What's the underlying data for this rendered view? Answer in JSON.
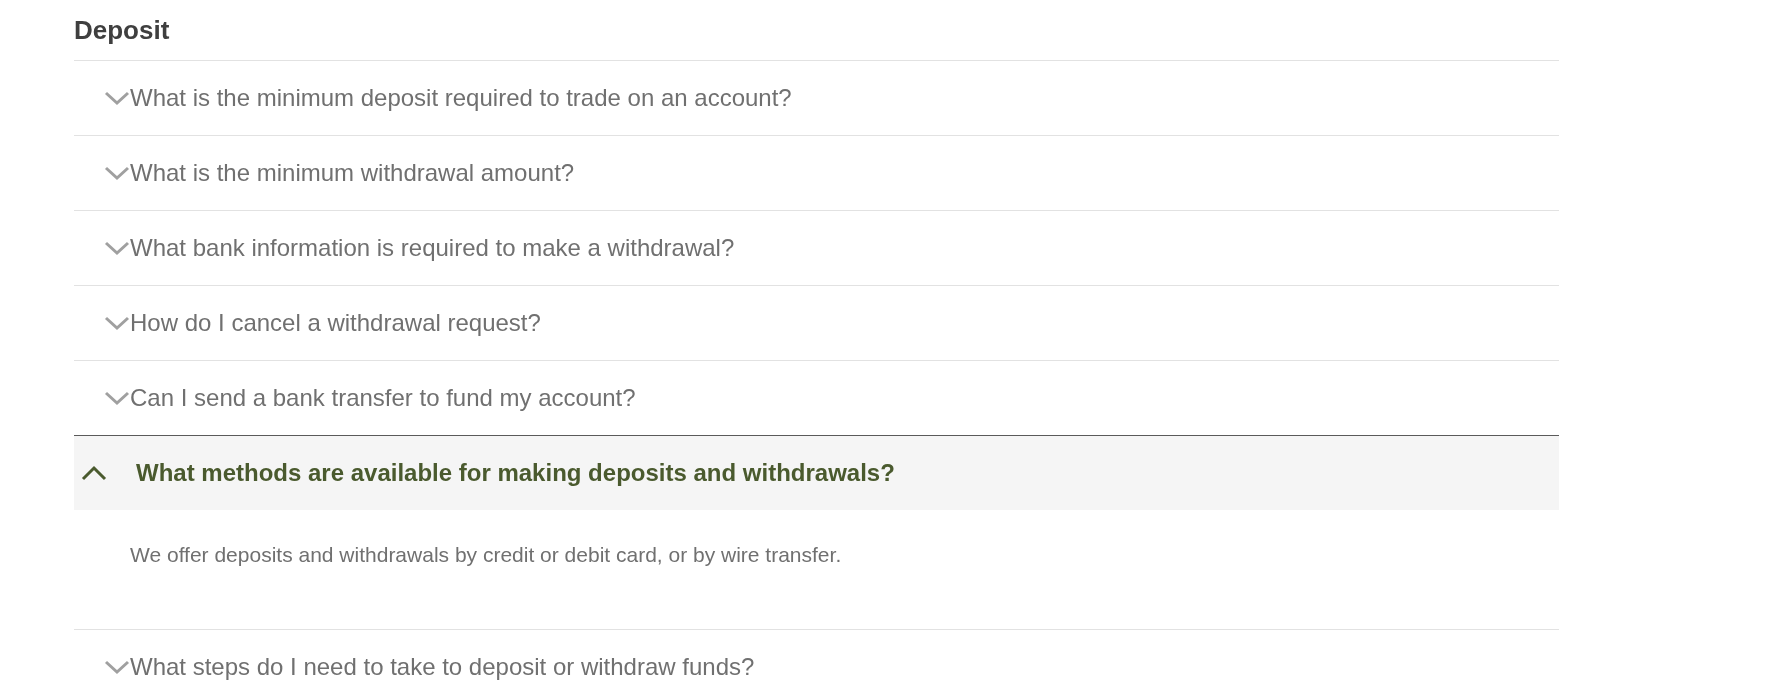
{
  "heading": "Deposit",
  "faq": [
    {
      "question": "What is the minimum deposit required to trade on an account?",
      "expanded": false
    },
    {
      "question": "What is the minimum withdrawal amount?",
      "expanded": false
    },
    {
      "question": "What bank information is required to make a withdrawal?",
      "expanded": false
    },
    {
      "question": "How do I cancel a withdrawal request?",
      "expanded": false
    },
    {
      "question": "Can I send a bank transfer to fund my account?",
      "expanded": false
    },
    {
      "question": "What methods are available for making deposits and withdrawals?",
      "expanded": true,
      "answer": "We offer deposits and withdrawals by credit or debit card, or by wire transfer."
    },
    {
      "question": "What steps do I need to take to deposit or withdraw funds?",
      "expanded": false
    }
  ]
}
